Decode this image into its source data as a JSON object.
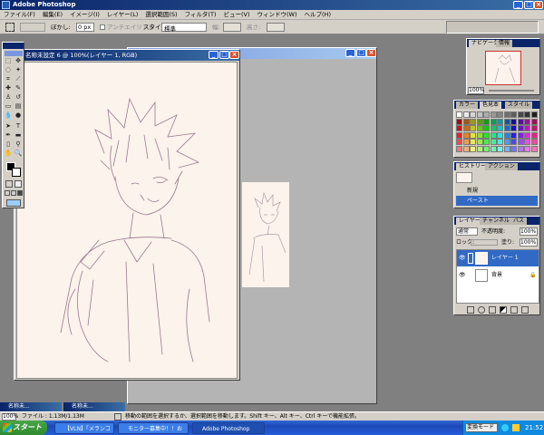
{
  "app": {
    "title": "Adobe Photoshop"
  },
  "menu": [
    "ファイル(F)",
    "編集(E)",
    "イメージ(I)",
    "レイヤー(L)",
    "選択範囲(S)",
    "フィルタ(T)",
    "ビュー(V)",
    "ウィンドウ(W)",
    "ヘルプ(H)"
  ],
  "options": {
    "feather_label": "ぼかし:",
    "feather_value": "0 px",
    "antialias_label": "アンチエイリアス",
    "style_label": "スタイル:",
    "style_value": "標準",
    "width_label": "幅:",
    "height_label": "高さ:"
  },
  "documents": {
    "front_title": "名称未設定 6 @ 100%(レイヤー 1, RGB)"
  },
  "navigator": {
    "tabs": [
      "ナビゲータ",
      "情報"
    ],
    "zoom": "100%"
  },
  "color_panel": {
    "tabs": [
      "カラー",
      "色見本",
      "スタイル"
    ]
  },
  "history_panel": {
    "tabs": [
      "ヒストリー",
      "アクション"
    ],
    "items": [
      "新規",
      "ペースト"
    ]
  },
  "layers_panel": {
    "tabs": [
      "レイヤー",
      "チャンネル",
      "パス"
    ],
    "blend_mode": "通常",
    "opacity_label": "不透明度:",
    "opacity_value": "100%",
    "lock_label": "ロック:",
    "fill_label": "塗り:",
    "fill_value": "100%",
    "layers": [
      "レイヤー 1",
      "背景"
    ]
  },
  "status": {
    "zoom": "100%",
    "file_info": "ファイル : 1.13M/1.13M",
    "hint": "移動の範囲を選択するか、選択範囲を移動します。Shift キー、Alt キー、Ctrl キーで機能拡張。"
  },
  "doc_taskbar": [
    "名称未...",
    "名称未..."
  ],
  "taskbar": {
    "start": "スタート",
    "buttons": [
      "【VLN】「メランコリック」...",
      "モニター募集中！！お絵...",
      "Adobe Photoshop"
    ],
    "ime": "変換モード",
    "clock": "21:52"
  },
  "colors": {
    "title_active": "#0a246a",
    "title_gradient_end": "#3a6ea5",
    "workspace": "#808080",
    "chrome": "#d4d0c8",
    "canvas": "#fbf3ec",
    "sketch_line": "#9a7a90"
  }
}
